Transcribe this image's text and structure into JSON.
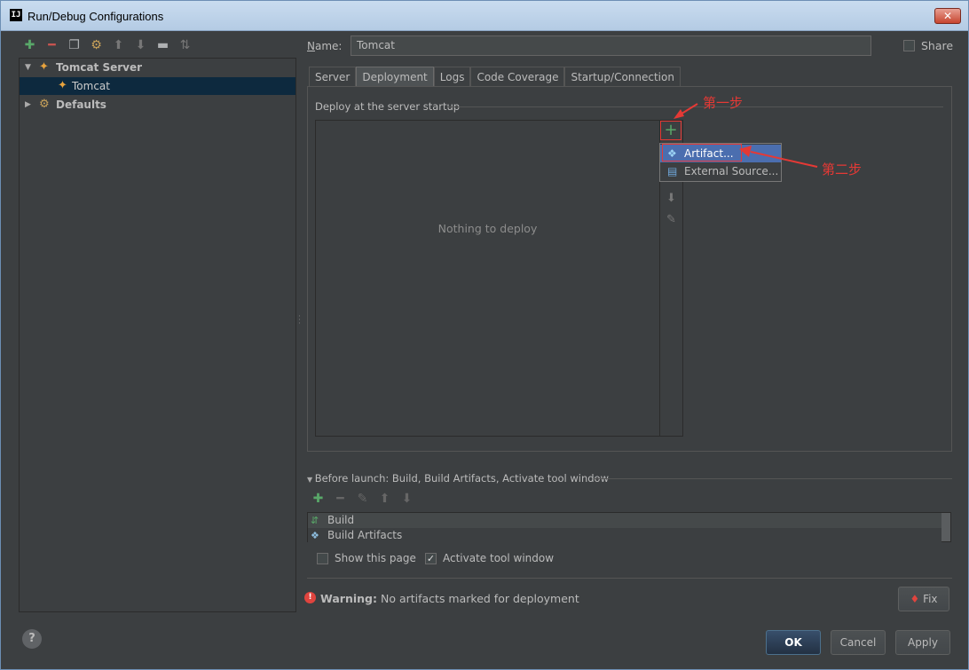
{
  "window": {
    "title": "Run/Debug Configurations",
    "app_icon": "IJ",
    "close": "✕"
  },
  "tree": {
    "toolbar_icons": [
      "add-icon",
      "remove-icon",
      "copy-icon",
      "settings-icon",
      "up-icon",
      "down-icon",
      "folder-icon",
      "sort-icon"
    ],
    "items": [
      {
        "label": "Tomcat Server",
        "expanded": true
      },
      {
        "label": "Tomcat",
        "selected": true
      },
      {
        "label": "Defaults",
        "expanded": false
      }
    ]
  },
  "name": {
    "label": "Name:",
    "value": "Tomcat"
  },
  "share": {
    "label": "Share",
    "checked": false
  },
  "tabs": [
    "Server",
    "Deployment",
    "Logs",
    "Code Coverage",
    "Startup/Connection"
  ],
  "active_tab": "Deployment",
  "deployment": {
    "section_title": "Deploy at the server startup",
    "empty_text": "Nothing to deploy",
    "add_symbol": "+",
    "popup_items": [
      "Artifact...",
      "External Source..."
    ]
  },
  "annotations": {
    "step1": "第一步",
    "step2": "第二步"
  },
  "before_launch": {
    "title": "Before launch: Build, Build Artifacts, Activate tool window",
    "items": [
      "Build",
      "Build Artifacts"
    ]
  },
  "options": {
    "show_this_page": {
      "label": "Show this page",
      "checked": false
    },
    "activate_tool_window": {
      "label": "Activate tool window",
      "checked": true
    }
  },
  "warning": {
    "prefix": "Warning:",
    "text": "No artifacts marked for deployment",
    "fix": "Fix"
  },
  "buttons": {
    "ok": "OK",
    "cancel": "Cancel",
    "apply": "Apply",
    "help": "?"
  },
  "colors": {
    "accent": "#4b6eaf",
    "annotation": "#e53935",
    "add_green": "#59a869"
  }
}
